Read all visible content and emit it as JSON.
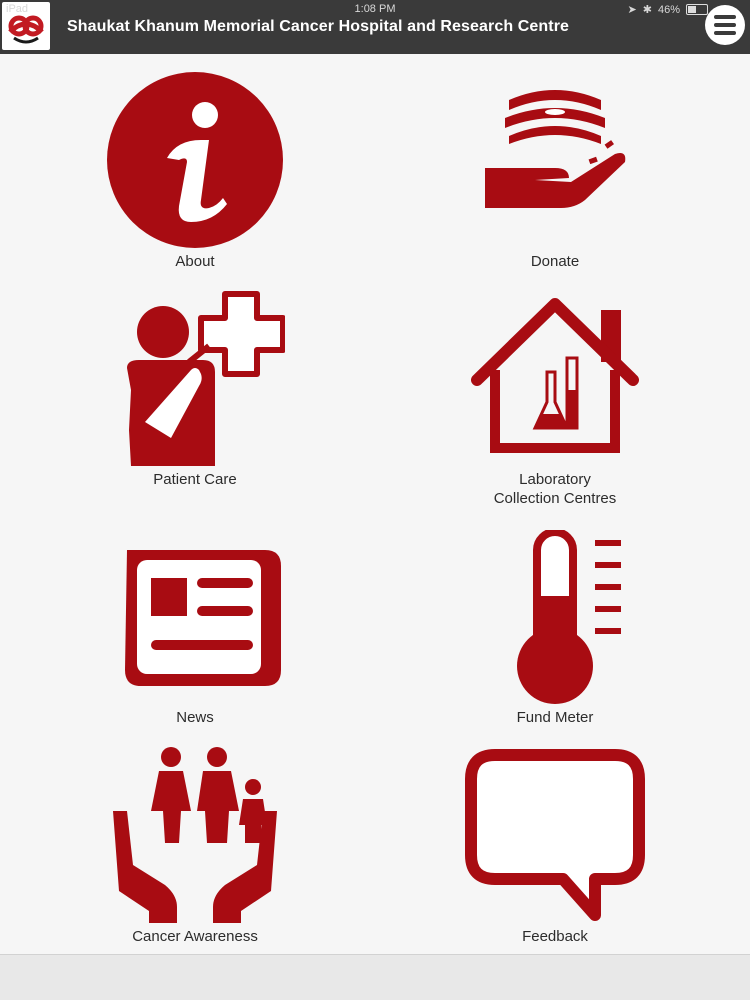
{
  "status_bar": {
    "device": "iPad",
    "time": "1:08 PM",
    "battery": "46%",
    "battery_level": 0.46
  },
  "header": {
    "title": "Shaukat Khanum Memorial Cancer Hospital and Research Centre"
  },
  "menu": {
    "icon": "hamburger-menu-icon"
  },
  "tiles": [
    {
      "label": "About",
      "icon": "info-icon"
    },
    {
      "label": "Donate",
      "icon": "donate-hand-icon"
    },
    {
      "label": "Patient Care",
      "icon": "patient-care-icon"
    },
    {
      "label": "Laboratory\nCollection Centres",
      "icon": "laboratory-house-icon"
    },
    {
      "label": "News",
      "icon": "newspaper-icon"
    },
    {
      "label": "Fund Meter",
      "icon": "thermometer-icon"
    },
    {
      "label": "Cancer Awareness",
      "icon": "family-in-hands-icon"
    },
    {
      "label": "Feedback",
      "icon": "speech-bubble-icon"
    }
  ],
  "colors": {
    "accent": "#a80c12",
    "header_bg": "#3a3a3a",
    "background": "#f6f6f6"
  }
}
